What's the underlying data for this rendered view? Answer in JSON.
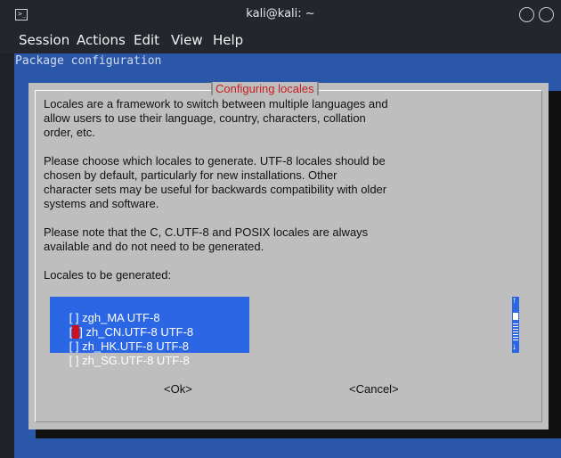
{
  "window": {
    "title": "kali@kali: ~",
    "icon": "terminal-icon"
  },
  "menu": [
    "Session",
    "Actions",
    "Edit",
    "View",
    "Help"
  ],
  "terminal": {
    "header_text": "Package configuration"
  },
  "dialog": {
    "title": "Configuring locales",
    "paragraphs": [
      "Locales are a framework to switch between multiple languages and\nallow users to use their language, country, characters, collation\norder, etc.",
      "Please choose which locales to generate. UTF-8 locales should be\nchosen by default, particularly for new installations. Other\ncharacter sets may be useful for backwards compatibility with older\nsystems and software.",
      "Please note that the C, C.UTF-8 and POSIX locales are always\navailable and do not need to be generated.",
      "Locales to be generated:"
    ],
    "locales": [
      {
        "checkbox": "[ ]",
        "name": "zgh_MA UTF-8",
        "selected": false
      },
      {
        "checkbox": "[ ]",
        "name": "zh_CN.UTF-8 UTF-8",
        "selected": true
      },
      {
        "checkbox": "[ ]",
        "name": "zh_HK.UTF-8 UTF-8",
        "selected": false
      },
      {
        "checkbox": "[ ]",
        "name": "zh_SG.UTF-8 UTF-8",
        "selected": false
      }
    ],
    "scrollbar": {
      "up": "↑",
      "down": "↓"
    },
    "ok_label": "<Ok>",
    "cancel_label": "<Cancel>"
  },
  "colors": {
    "terminal_bg": "#2b57a8",
    "dialog_bg": "#bebebe",
    "list_bg": "#2b66e5",
    "title_red": "#c81e1e",
    "cursor": "#d30f1a"
  }
}
